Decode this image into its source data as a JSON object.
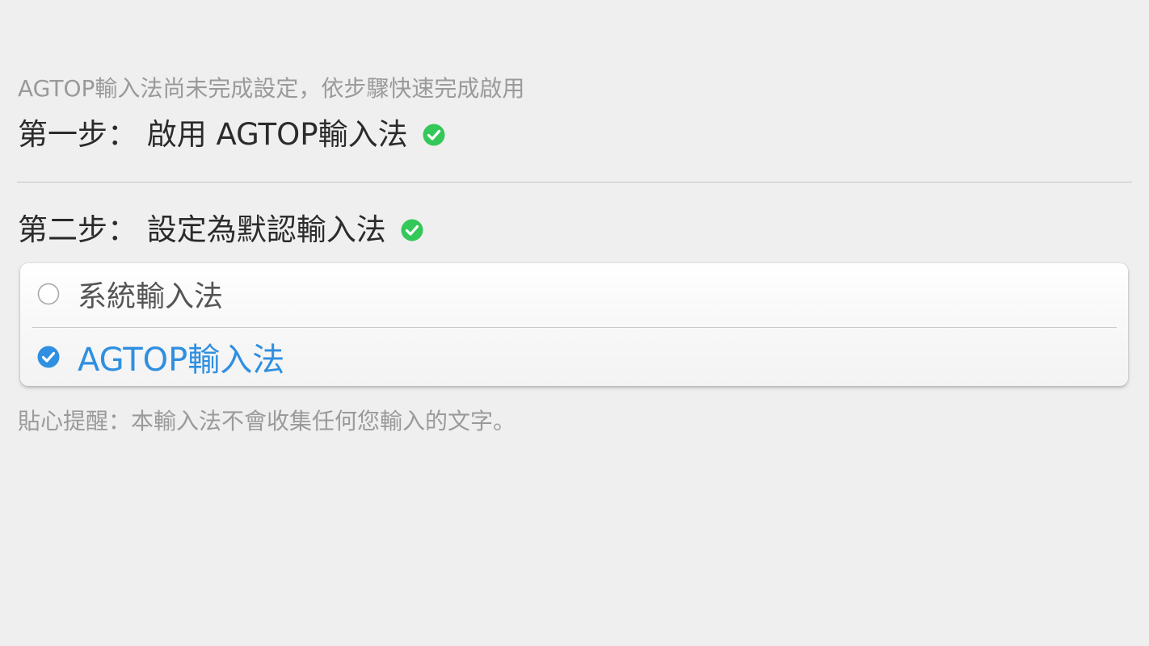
{
  "header": {
    "subtitle": "AGTOP輸入法尚未完成設定，依步驟快速完成啟用"
  },
  "steps": [
    {
      "label": "第一步： 啟用 AGTOP輸入法",
      "status": "done",
      "status_icon": "check-circle-icon",
      "status_color": "#34c759"
    },
    {
      "label": "第二步： 設定為默認輸入法",
      "status": "done",
      "status_icon": "check-circle-icon",
      "status_color": "#34c759"
    }
  ],
  "input_methods": {
    "options": [
      {
        "label": "系統輸入法",
        "selected": false
      },
      {
        "label": "AGTOP輸入法",
        "selected": true
      }
    ],
    "selected_color": "#2f8fe0"
  },
  "footer": {
    "tip": "貼心提醒：本輸入法不會收集任何您輸入的文字。"
  }
}
